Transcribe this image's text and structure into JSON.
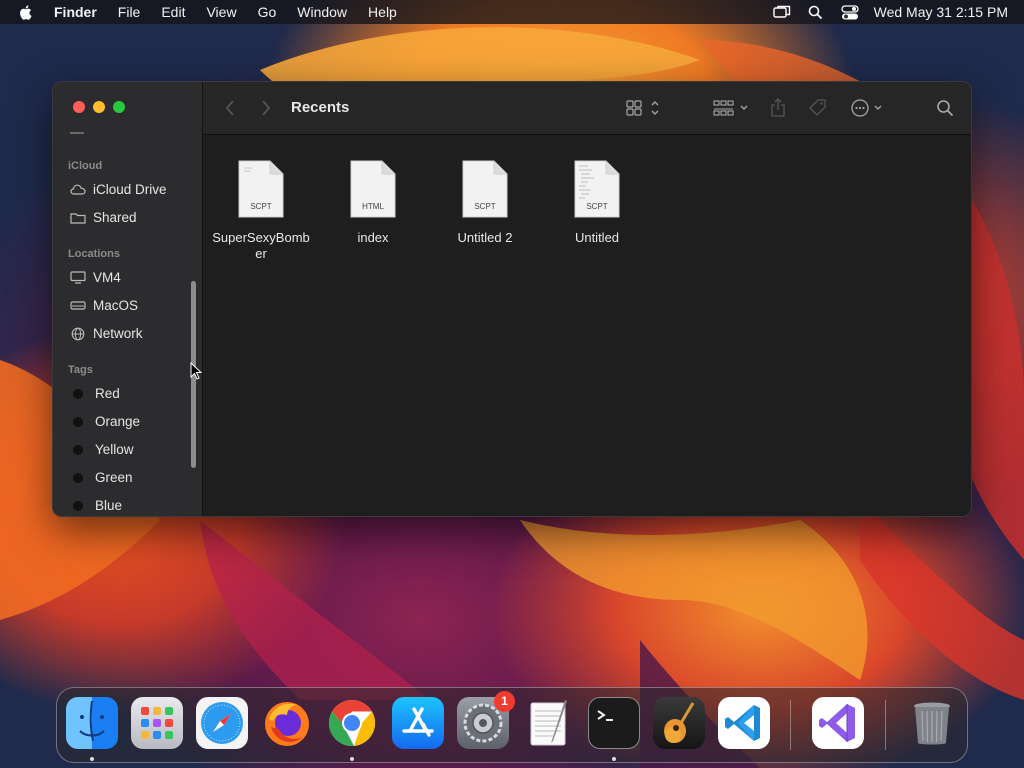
{
  "menubar": {
    "app_name": "Finder",
    "items": [
      "File",
      "Edit",
      "View",
      "Go",
      "Window",
      "Help"
    ],
    "clock": "Wed May 31  2:15 PM",
    "status_icons": [
      "screen-mirroring-icon",
      "spotlight-icon",
      "control-center-icon"
    ]
  },
  "window": {
    "title": "Recents",
    "traffic_colors": {
      "close": "#ff5f57",
      "minimize": "#febc2e",
      "zoom": "#28c840"
    }
  },
  "sidebar": {
    "sections": {
      "icloud": "iCloud",
      "locations": "Locations",
      "tags": "Tags"
    },
    "icloud_items": [
      {
        "label": "iCloud Drive",
        "icon": "cloud-icon"
      },
      {
        "label": "Shared",
        "icon": "shared-folder-icon"
      }
    ],
    "location_items": [
      {
        "label": "VM4",
        "icon": "display-icon"
      },
      {
        "label": "MacOS",
        "icon": "disk-icon"
      },
      {
        "label": "Network",
        "icon": "globe-icon"
      }
    ],
    "tag_items": [
      {
        "label": "Red"
      },
      {
        "label": "Orange"
      },
      {
        "label": "Yellow"
      },
      {
        "label": "Green"
      },
      {
        "label": "Blue"
      }
    ]
  },
  "files": [
    {
      "name": "SuperSexyBomber",
      "ext": "SCPT"
    },
    {
      "name": "index",
      "ext": "HTML"
    },
    {
      "name": "Untitled 2",
      "ext": "SCPT"
    },
    {
      "name": "Untitled",
      "ext": "SCPT"
    }
  ],
  "dock": {
    "apps": [
      "Finder",
      "Launchpad",
      "Safari",
      "Firefox",
      "Google Chrome",
      "App Store",
      "System Preferences",
      "TextEdit",
      "Terminal",
      "GarageBand",
      "Visual Studio Code",
      "Visual Studio",
      "Trash"
    ],
    "system_preferences_badge": "1"
  }
}
